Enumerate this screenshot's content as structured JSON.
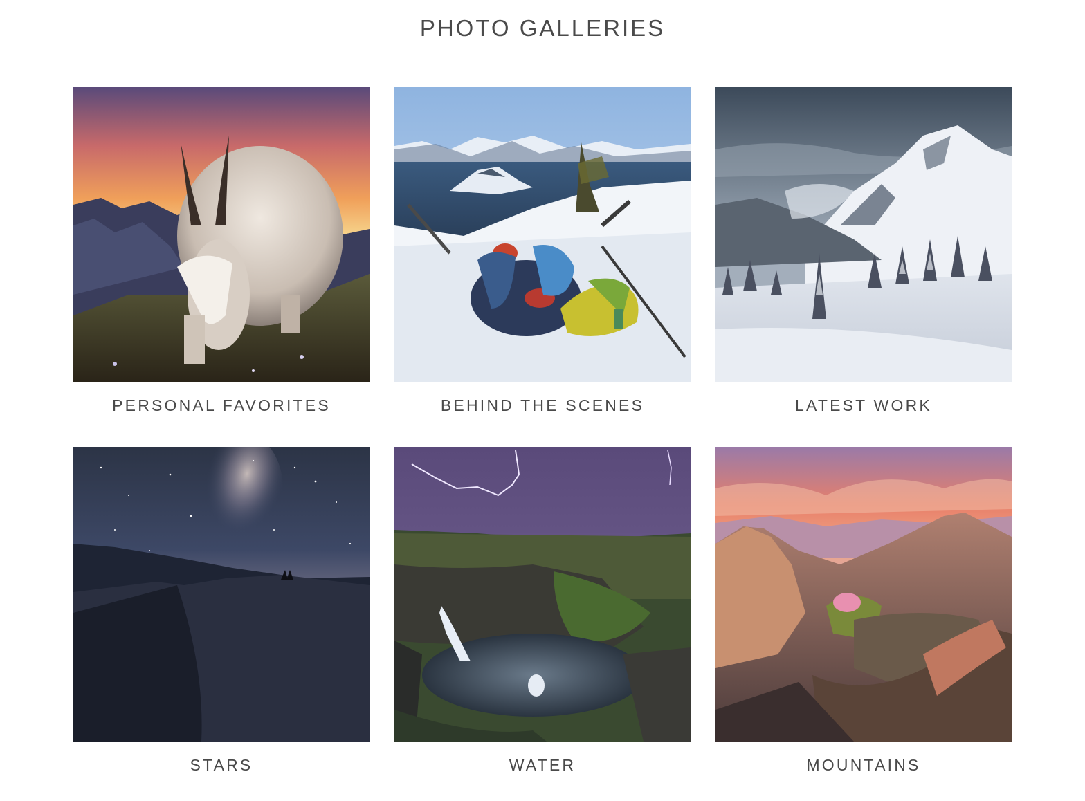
{
  "page": {
    "title": "PHOTO GALLERIES"
  },
  "galleries": [
    {
      "label": "PERSONAL FAVORITES",
      "image": "mountain-goat-sunset"
    },
    {
      "label": "BEHIND THE SCENES",
      "image": "snow-camp-crater-lake"
    },
    {
      "label": "LATEST WORK",
      "image": "snowy-mountain-forest"
    },
    {
      "label": "STARS",
      "image": "milky-way-dunes"
    },
    {
      "label": "WATER",
      "image": "waterfall-lightning-canyon"
    },
    {
      "label": "MOUNTAINS",
      "image": "pink-sunset-mountains"
    }
  ]
}
